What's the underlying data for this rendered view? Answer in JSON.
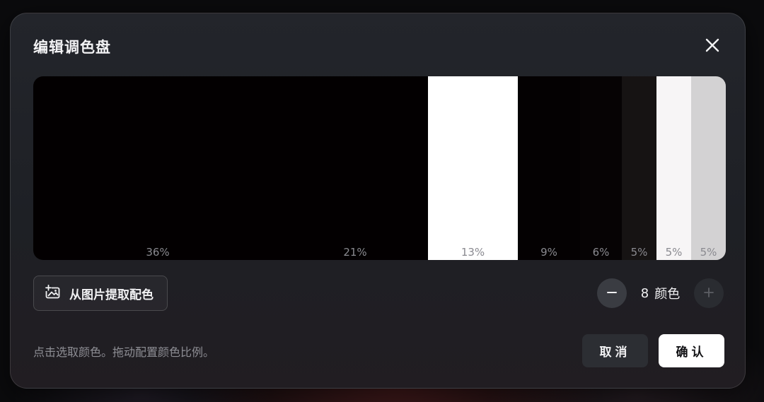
{
  "dialog": {
    "title": "编辑调色盘",
    "close_icon": "close-icon"
  },
  "palette": {
    "swatches": [
      {
        "color": "#030001",
        "percent_value": 36,
        "percent_label": "36%"
      },
      {
        "color": "#030001",
        "percent_value": 21,
        "percent_label": "21%"
      },
      {
        "color": "#ffffff",
        "percent_value": 13,
        "percent_label": "13%"
      },
      {
        "color": "#040102",
        "percent_value": 9,
        "percent_label": "9%"
      },
      {
        "color": "#060304",
        "percent_value": 6,
        "percent_label": "6%"
      },
      {
        "color": "#161313",
        "percent_value": 5,
        "percent_label": "5%"
      },
      {
        "color": "#f7f5f6",
        "percent_value": 5,
        "percent_label": "5%"
      },
      {
        "color": "#d3d2d3",
        "percent_value": 5,
        "percent_label": "5%"
      }
    ]
  },
  "extract": {
    "label": "从图片提取配色",
    "icon": "image-add-icon"
  },
  "count": {
    "value": "8",
    "unit": "颜色"
  },
  "hint": "点击选取颜色。拖动配置颜色比例。",
  "actions": {
    "cancel_label": "取消",
    "confirm_label": "确认"
  }
}
